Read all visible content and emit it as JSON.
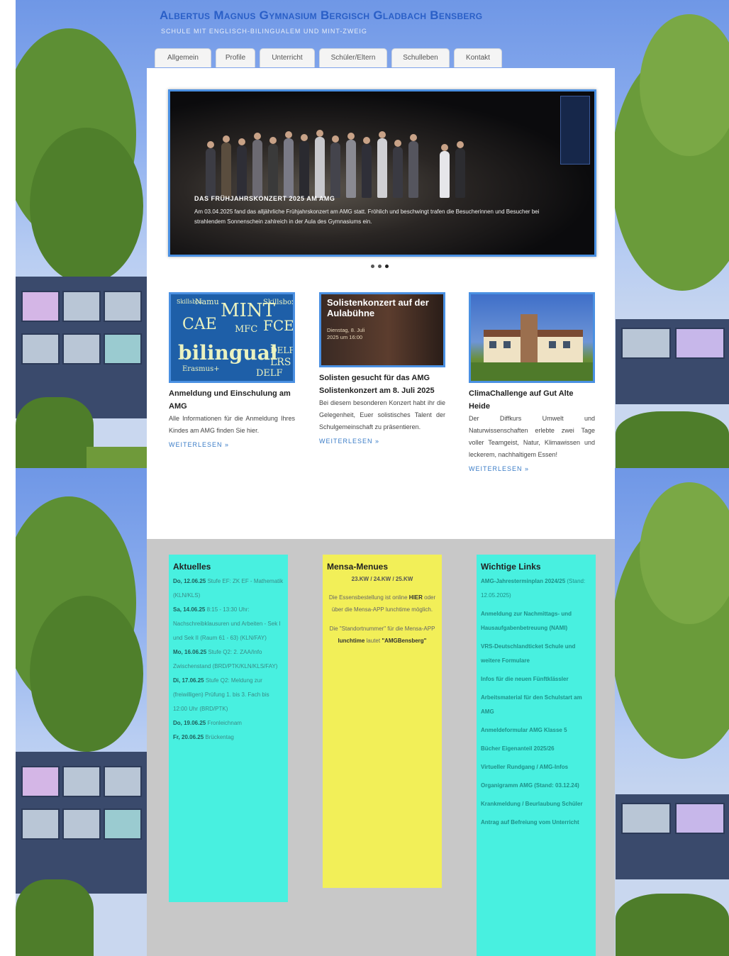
{
  "site": {
    "title": "Albertus Magnus Gymnasium Bergisch Gladbach Bensberg",
    "subtitle": "SCHULE MIT ENGLISCH-BILINGUALEM UND MINT-ZWEIG"
  },
  "nav": {
    "tabs": [
      {
        "label": "Allgemein"
      },
      {
        "label": "Profile"
      },
      {
        "label": "Unterricht"
      },
      {
        "label": "Schüler/Eltern"
      },
      {
        "label": "Schulleben"
      },
      {
        "label": "Kontakt"
      }
    ]
  },
  "slider": {
    "title": "DAS FRÜHJAHRSKONZERT 2025 AM AMG",
    "text": "Am 03.04.2025 fand das alljährliche Frühjahrskonzert am AMG statt. Fröhlich und beschwingt trafen die Besucherinnen und Besucher bei strahlendem Sonnenschein zahlreich in der Aula des Gymnasiums ein.",
    "slide_count": 3,
    "active_slide": 3
  },
  "teasers": [
    {
      "title": "Anmeldung und Einschulung am AMG",
      "text": "Alle Informationen für die Anmeldung Ihres Kindes am AMG finden Sie hier.",
      "more": "WEITERLESEN »",
      "image_words": [
        "MINT",
        "CAE",
        "FCE",
        "bilingual",
        "LRS",
        "DELF",
        "MFC",
        "Skillsbox",
        "Namu",
        "Erasmus+"
      ]
    },
    {
      "title": "Solisten gesucht für das AMG Solistenkonzert am 8. Juli 2025",
      "text": "Bei diesem besonderen Konzert habt ihr die Gelegenheit, Euer solistisches Talent der Schulgemeinschaft zu präsentieren.",
      "more": "WEITERLESEN »",
      "image_title": "Solistenkonzert auf der Aulabühne",
      "image_date": "Dienstag, 8. Juli 2025 um 16:00"
    },
    {
      "title": "ClimaChallenge auf Gut Alte Heide",
      "text": "Der Diffkurs Umwelt und Naturwissenschaften erlebte zwei Tage voller Teamgeist, Natur, Klimawissen und leckerem, nachhaltigem Essen!",
      "more": "WEITERLESEN »"
    }
  ],
  "aktuelles": {
    "heading": "Aktuelles",
    "entries": [
      {
        "date": "Do, 12.06.25",
        "text": " Stufe EF: ZK EF - Mathematik (KLN/KLS)"
      },
      {
        "date": "Sa, 14.06.25",
        "text": " 8:15 - 13:30 Uhr: Nachschreibklausuren und Arbeiten - Sek I und Sek II (Raum 61 - 63) (KLN/FAY)"
      },
      {
        "date": "Mo, 16.06.25",
        "text": " Stufe Q2: 2. ZAA/Info Zwischenstand (BRD/PTK/KLN/KLS/FAY)"
      },
      {
        "date": "Di, 17.06.25",
        "text": " Stufe Q2: Meldung zur (freiwilligen) Prüfung 1. bis 3. Fach bis 12:00 Uhr (BRD/PTK)"
      },
      {
        "date": "Do, 19.06.25",
        "text": " Fronleichnam"
      },
      {
        "date": "Fr, 20.06.25",
        "text": " Brückentag"
      }
    ]
  },
  "mensa": {
    "heading": "Mensa-Menues",
    "weeks": "23.KW / 24.KW / 25.KW",
    "p1_a": "Die Essensbestellung ist online ",
    "p1_link": "HIER",
    "p1_b": " oder über die Mensa-APP lunchtime möglich.",
    "p2_a": "Die \"Standortnummer\" für die Mensa-APP ",
    "p2_bold": "lunchtime",
    "p2_b": " lautet ",
    "p2_code": "\"AMGBensberg\""
  },
  "links": {
    "heading": "Wichtige Links",
    "items": [
      {
        "label": "AMG-Jahresterminplan 2024/25",
        "stand": " (Stand: 12.05.2025)"
      },
      {
        "label": "Anmeldung zur Nachmittags- und Hausaufgabenbetreuung (NAMI)",
        "stand": ""
      },
      {
        "label": "VRS-Deutschlandticket Schule und weitere Formulare",
        "stand": ""
      },
      {
        "label": "Infos für die neuen Fünftklässler",
        "stand": ""
      },
      {
        "label": "Arbeitsmaterial für den Schulstart am AMG",
        "stand": ""
      },
      {
        "label": "Anmeldeformular AMG Klasse 5",
        "stand": ""
      },
      {
        "label": "Bücher Eigenanteil 2025/26",
        "stand": ""
      },
      {
        "label": "Virtueller Rundgang / AMG-Infos",
        "stand": ""
      },
      {
        "label": "Organigramm AMG (Stand: 03.12.24)",
        "stand": ""
      },
      {
        "label": "Krankmeldung / Beurlaubung Schüler",
        "stand": ""
      },
      {
        "label": "Antrag auf Befreiung vom Unterricht",
        "stand": ""
      }
    ]
  },
  "colors": {
    "accent": "#4a90e2",
    "title_blue": "#2a5fc7",
    "widget_cyan": "#48f0e0",
    "widget_yellow": "#f2ef58",
    "footer_gray": "#c8c8c8"
  }
}
